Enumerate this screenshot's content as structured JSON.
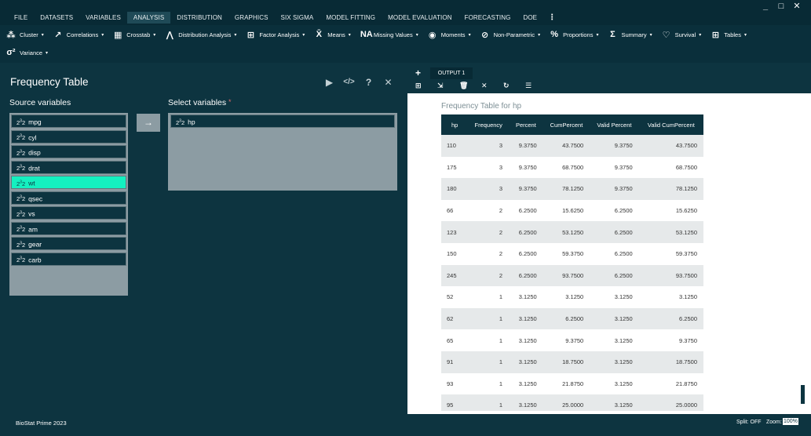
{
  "menubar": {
    "items": [
      "FILE",
      "DATASETS",
      "VARIABLES",
      "ANALYSIS",
      "DISTRIBUTION",
      "GRAPHICS",
      "SIX SIGMA",
      "MODEL FITTING",
      "MODEL EVALUATION",
      "FORECASTING",
      "DOE"
    ],
    "active": "ANALYSIS",
    "more": "⋮",
    "win_minimize": "_",
    "win_maximize": "□",
    "win_close": "✕"
  },
  "toolbar": {
    "row1": [
      {
        "label": "Cluster",
        "icon": "cluster-icon",
        "glyph": "⁂"
      },
      {
        "label": "Correlations",
        "icon": "correlations-icon",
        "glyph": "↗"
      },
      {
        "label": "Crosstab",
        "icon": "crosstab-icon",
        "glyph": "▦"
      },
      {
        "label": "Distribution Analysis",
        "icon": "distribution-icon",
        "glyph": "⋀"
      },
      {
        "label": "Factor Analysis",
        "icon": "factor-icon",
        "glyph": "⊞"
      },
      {
        "label": "Means",
        "icon": "means-icon",
        "glyph": "X̄"
      },
      {
        "label": "Missing Values",
        "icon": "missing-values-icon",
        "glyph": "NA"
      },
      {
        "label": "Moments",
        "icon": "moments-icon",
        "glyph": "◉"
      },
      {
        "label": "Non-Parametric",
        "icon": "nonparametric-icon",
        "glyph": "⊘"
      },
      {
        "label": "Proportions",
        "icon": "proportions-icon",
        "glyph": "%"
      },
      {
        "label": "Summary",
        "icon": "summary-icon",
        "glyph": "Σ"
      },
      {
        "label": "Survival",
        "icon": "survival-icon",
        "glyph": "♡"
      },
      {
        "label": "Tables",
        "icon": "tables-icon",
        "glyph": "⊞"
      }
    ],
    "row2": [
      {
        "label": "Variance",
        "icon": "variance-icon",
        "glyph": "σ²"
      }
    ],
    "caret": "▾"
  },
  "left_panel": {
    "title": "Frequency Table",
    "actions": {
      "run": "▶",
      "code": "</>",
      "help": "?",
      "close": "✕"
    },
    "source_label": "Source variables",
    "target_label": "Select variables",
    "required_mark": "*",
    "move_glyph": "→",
    "var_type_glyph": "2",
    "var_type_sup": "3",
    "source_vars": [
      "mpg",
      "cyl",
      "disp",
      "drat",
      "wt",
      "qsec",
      "vs",
      "am",
      "gear",
      "carb"
    ],
    "selected_source": "wt",
    "target_vars": [
      "hp"
    ]
  },
  "output": {
    "add_tab": "+",
    "tab_label": "OUTPUT 1",
    "tools": [
      {
        "name": "add-output-icon",
        "glyph": "⊞"
      },
      {
        "name": "export-icon",
        "glyph": "⇲"
      },
      {
        "name": "delete-icon",
        "glyph": "🗑"
      },
      {
        "name": "clear-icon",
        "glyph": "✕"
      },
      {
        "name": "refresh-icon",
        "glyph": "↻"
      },
      {
        "name": "list-icon",
        "glyph": "☰"
      }
    ],
    "title": "Frequency Table for hp",
    "table": {
      "headers": [
        "hp",
        "Frequency",
        "Percent",
        "CumPercent",
        "Valid Percent",
        "Valid CumPercent"
      ],
      "rows": [
        [
          "110",
          "3",
          "9.3750",
          "43.7500",
          "9.3750",
          "43.7500"
        ],
        [
          "175",
          "3",
          "9.3750",
          "68.7500",
          "9.3750",
          "68.7500"
        ],
        [
          "180",
          "3",
          "9.3750",
          "78.1250",
          "9.3750",
          "78.1250"
        ],
        [
          "66",
          "2",
          "6.2500",
          "15.6250",
          "6.2500",
          "15.6250"
        ],
        [
          "123",
          "2",
          "6.2500",
          "53.1250",
          "6.2500",
          "53.1250"
        ],
        [
          "150",
          "2",
          "6.2500",
          "59.3750",
          "6.2500",
          "59.3750"
        ],
        [
          "245",
          "2",
          "6.2500",
          "93.7500",
          "6.2500",
          "93.7500"
        ],
        [
          "52",
          "1",
          "3.1250",
          "3.1250",
          "3.1250",
          "3.1250"
        ],
        [
          "62",
          "1",
          "3.1250",
          "6.2500",
          "3.1250",
          "6.2500"
        ],
        [
          "65",
          "1",
          "3.1250",
          "9.3750",
          "3.1250",
          "9.3750"
        ],
        [
          "91",
          "1",
          "3.1250",
          "18.7500",
          "3.1250",
          "18.7500"
        ],
        [
          "93",
          "1",
          "3.1250",
          "21.8750",
          "3.1250",
          "21.8750"
        ],
        [
          "95",
          "1",
          "3.1250",
          "25.0000",
          "3.1250",
          "25.0000"
        ]
      ]
    }
  },
  "statusbar": {
    "app_name": "BioStat Prime 2023",
    "split": "Split: OFF",
    "zoom_label": "Zoom:",
    "zoom_value": "100%"
  },
  "colors": {
    "background": "#0d3440",
    "accent": "#14f0c0",
    "panel_gray": "#8c9ca3"
  }
}
